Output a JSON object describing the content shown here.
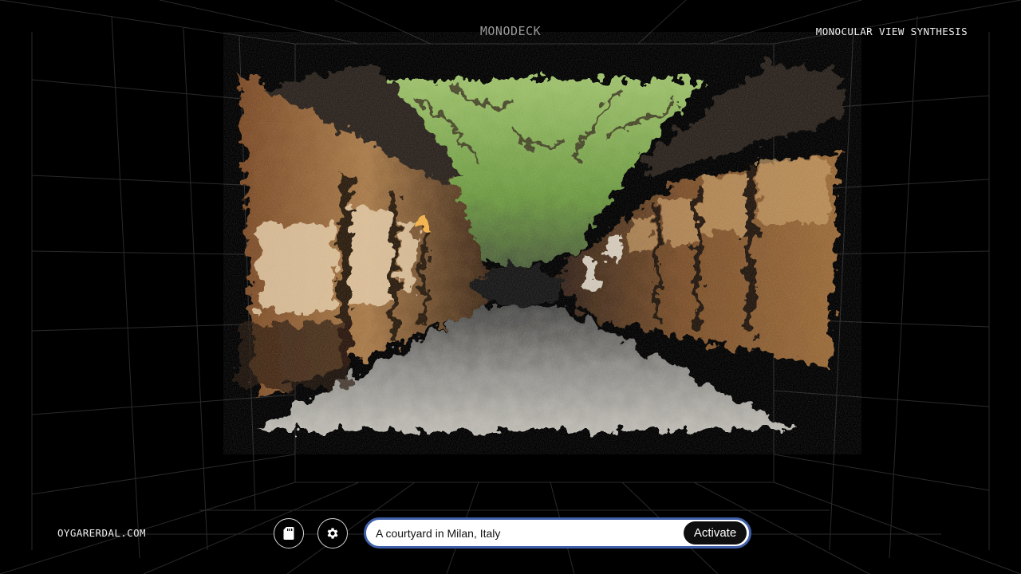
{
  "header": {
    "title": "MONODECK",
    "subtitle": "MONOCULAR VIEW SYNTHESIS"
  },
  "footer": {
    "site": "OYGARERDAL.COM"
  },
  "controls": {
    "file_icon": "sd-card-icon",
    "settings_icon": "gear-icon",
    "prompt_value": "A courtyard in Milan, Italy",
    "activate_label": "Activate"
  },
  "colors": {
    "background": "#000000",
    "grid_line": "#2a2a2a",
    "prompt_border": "#3f5fa8",
    "activate_bg": "#0e0e0e"
  },
  "scene": {
    "description_icon": "point-cloud-street-scene"
  }
}
